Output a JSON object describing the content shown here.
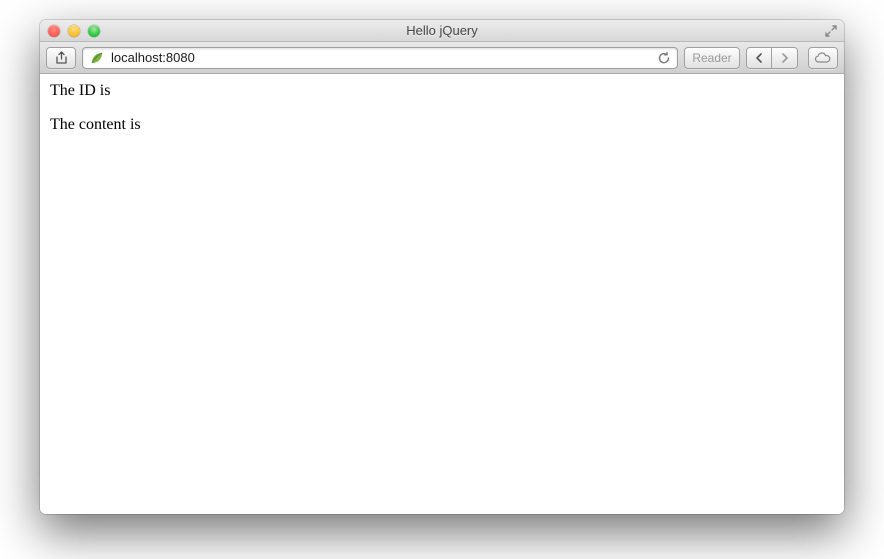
{
  "window": {
    "title": "Hello jQuery"
  },
  "toolbar": {
    "url": "localhost:8080",
    "reader_label": "Reader"
  },
  "page": {
    "line1": "The ID is",
    "line2": "The content is"
  }
}
